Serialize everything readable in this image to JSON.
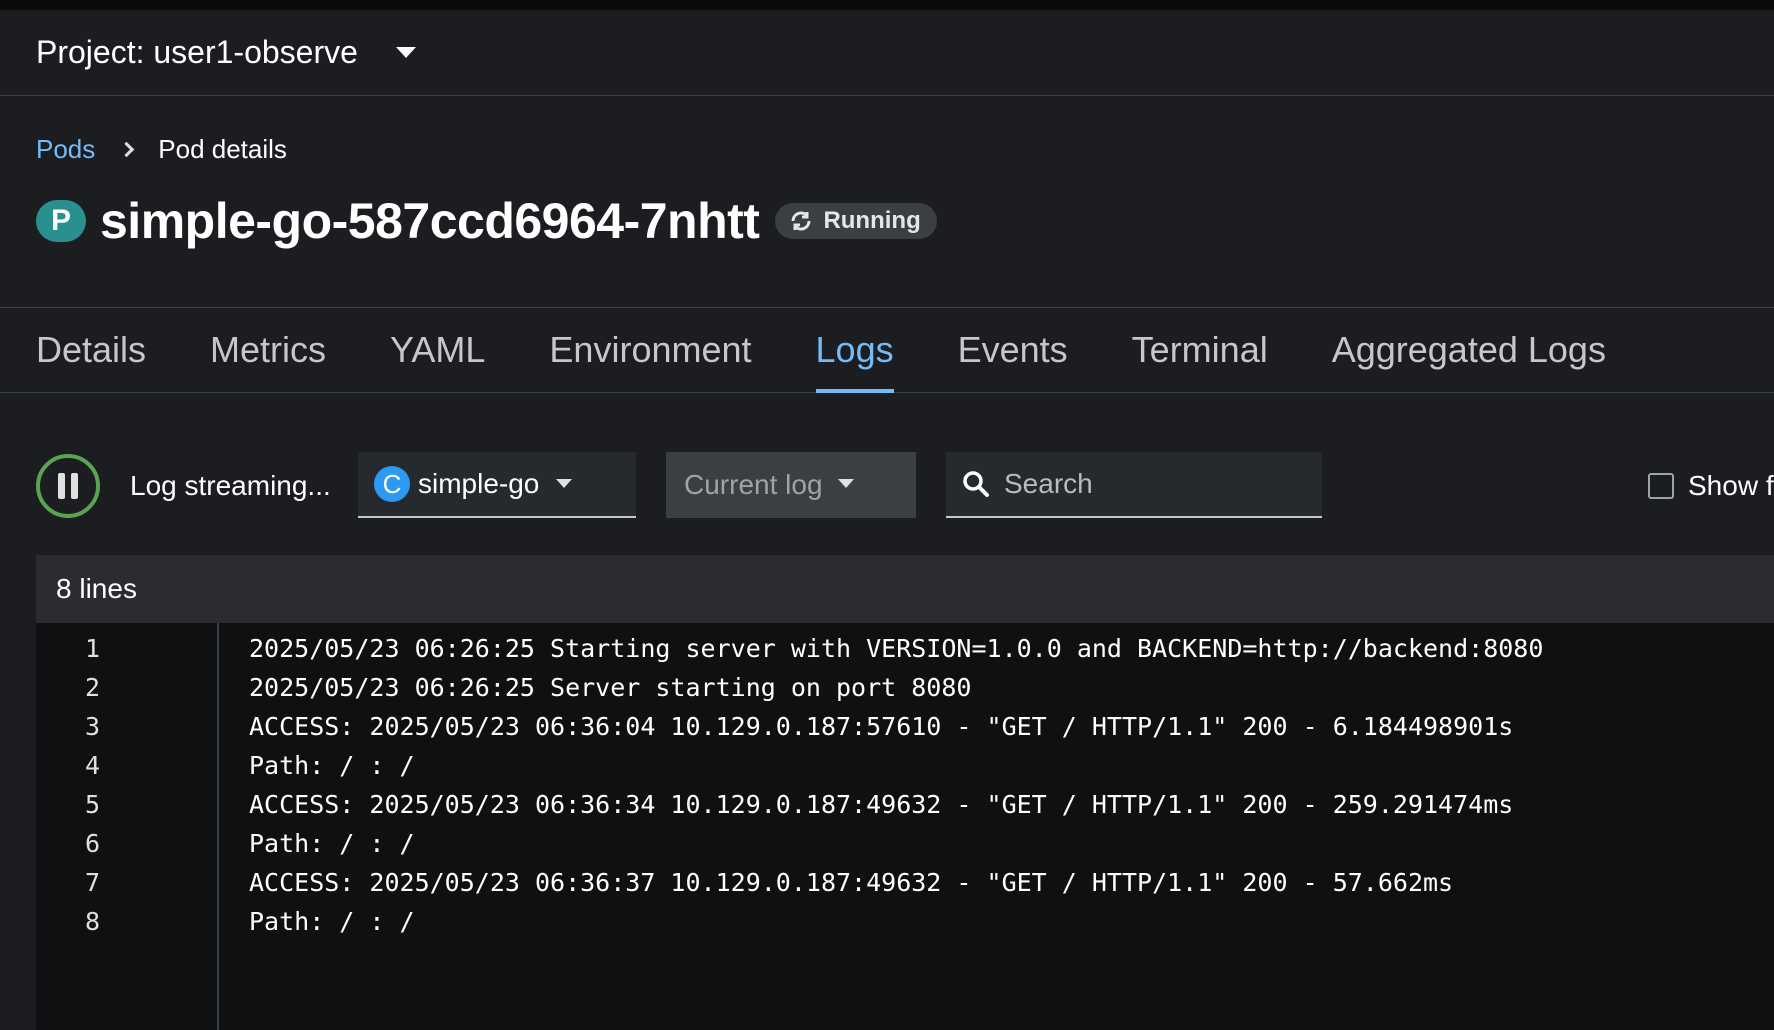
{
  "project": {
    "label": "Project: user1-observe"
  },
  "breadcrumb": {
    "parent": "Pods",
    "current": "Pod details"
  },
  "pod": {
    "badge": "P",
    "name": "simple-go-587ccd6964-7nhtt",
    "status": "Running"
  },
  "tabs": [
    {
      "label": "Details"
    },
    {
      "label": "Metrics"
    },
    {
      "label": "YAML"
    },
    {
      "label": "Environment"
    },
    {
      "label": "Logs",
      "active": true
    },
    {
      "label": "Events"
    },
    {
      "label": "Terminal"
    },
    {
      "label": "Aggregated Logs"
    }
  ],
  "toolbar": {
    "stream_label": "Log streaming...",
    "container_badge": "C",
    "container_name": "simple-go",
    "log_type": "Current log",
    "search_placeholder": "Search",
    "show_full_label": "Show f"
  },
  "logs": {
    "count_label": "8 lines",
    "lines": [
      {
        "num": "1",
        "text": "2025/05/23 06:26:25 Starting server with VERSION=1.0.0 and BACKEND=http://backend:8080"
      },
      {
        "num": "2",
        "text": "2025/05/23 06:26:25 Server starting on port 8080"
      },
      {
        "num": "3",
        "text": "ACCESS: 2025/05/23 06:36:04 10.129.0.187:57610 - \"GET / HTTP/1.1\" 200 - 6.184498901s"
      },
      {
        "num": "4",
        "text": "Path: / : /"
      },
      {
        "num": "5",
        "text": "ACCESS: 2025/05/23 06:36:34 10.129.0.187:49632 - \"GET / HTTP/1.1\" 200 - 259.291474ms"
      },
      {
        "num": "6",
        "text": "Path: / : /"
      },
      {
        "num": "7",
        "text": "ACCESS: 2025/05/23 06:36:37 10.129.0.187:49632 - \"GET / HTTP/1.1\" 200 - 57.662ms"
      },
      {
        "num": "8",
        "text": "Path: / : /"
      }
    ]
  },
  "colors": {
    "accent": "#73bcf7",
    "running": "#5ba352",
    "pod_badge": "#2a8f8f",
    "container_badge": "#2b9af3"
  },
  "icons": [
    "chevron-down-icon",
    "chevron-right-icon",
    "sync-icon",
    "pause-icon",
    "search-icon"
  ]
}
